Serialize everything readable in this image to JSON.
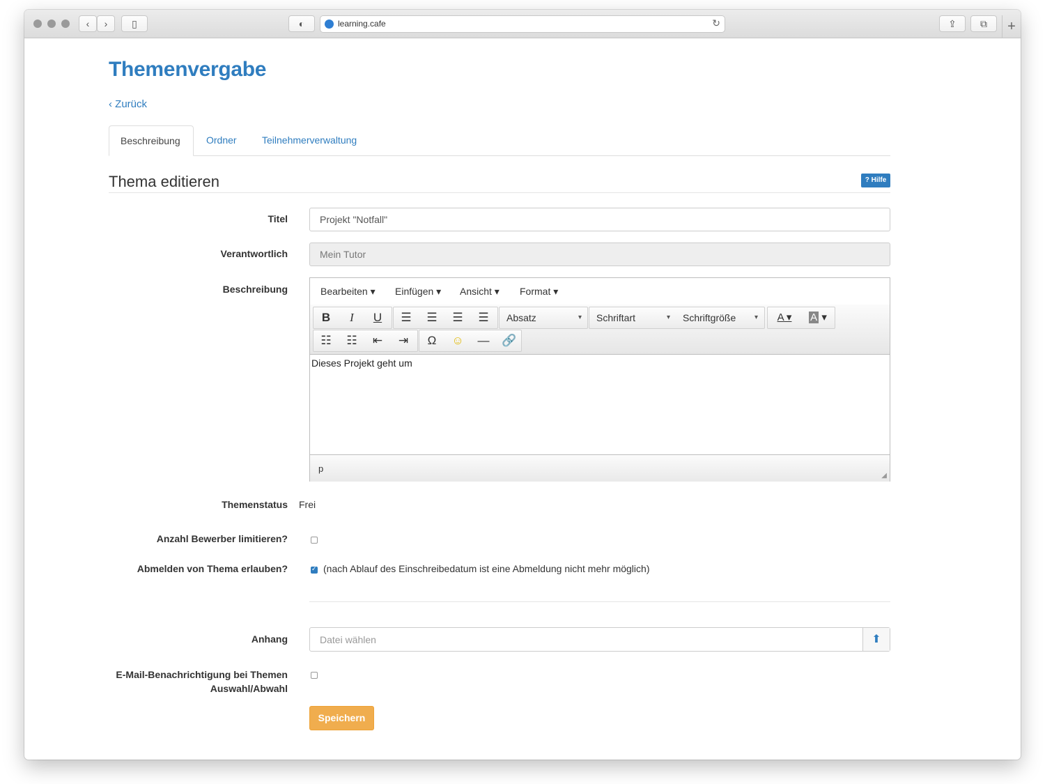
{
  "browser": {
    "url": "learning.cafe"
  },
  "page": {
    "title": "Themenvergabe",
    "back_label": "Zurück",
    "tabs": [
      {
        "label": "Beschreibung",
        "active": true
      },
      {
        "label": "Ordner",
        "active": false
      },
      {
        "label": "Teilnehmerverwaltung",
        "active": false
      }
    ],
    "section_title": "Thema editieren",
    "help_label": "Hilfe"
  },
  "form": {
    "titel": {
      "label": "Titel",
      "value": "Projekt \"Notfall\""
    },
    "verantwortlich": {
      "label": "Verantwortlich",
      "value": "Mein Tutor"
    },
    "beschreibung": {
      "label": "Beschreibung",
      "menu": [
        "Bearbeiten",
        "Einfügen",
        "Ansicht",
        "Format"
      ],
      "dropdowns": {
        "block": "Absatz",
        "font": "Schriftart",
        "size": "Schriftgröße"
      },
      "content": "Dieses Projekt geht um",
      "status_path": "p"
    },
    "themenstatus": {
      "label": "Themenstatus",
      "value": "Frei"
    },
    "anzahl_limitieren": {
      "label": "Anzahl Bewerber limitieren?",
      "checked": false
    },
    "abmelden": {
      "label": "Abmelden von Thema erlauben?",
      "checked": true,
      "note": "(nach Ablauf des Einschreibedatum ist eine Abmeldung nicht mehr möglich)"
    },
    "anhang": {
      "label": "Anhang",
      "placeholder": "Datei wählen"
    },
    "email": {
      "label_line1": "E-Mail-Benachrichtigung bei Themen",
      "label_line2": "Auswahl/Abwahl",
      "checked": false
    },
    "save_label": "Speichern"
  },
  "colors": {
    "accent": "#2f7dbf",
    "save": "#f0ad4e"
  }
}
